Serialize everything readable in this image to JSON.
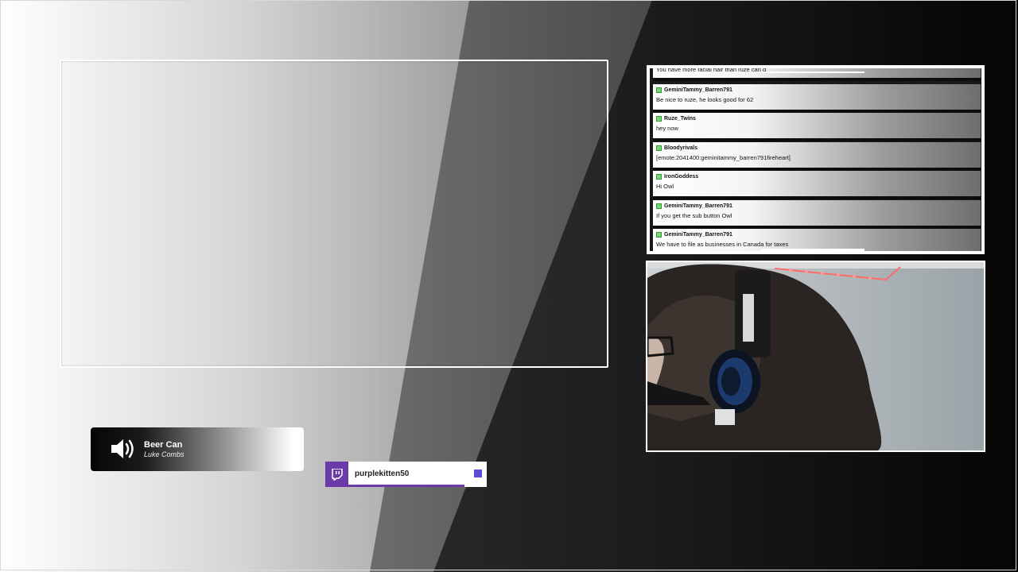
{
  "chat": {
    "messages": [
      {
        "user": "",
        "text": "You have more facial hair than ruze can g"
      },
      {
        "user": "GeminiTammy_Barren791",
        "text": "Be nice to ruze, he looks good for 62"
      },
      {
        "user": "Ruze_Twins",
        "text": "hey now"
      },
      {
        "user": "Bloodyrivals",
        "text": "[emote:2041400:geminitammy_barren791fireheart]"
      },
      {
        "user": "IronGoddess",
        "text": "Hi Owl"
      },
      {
        "user": "GeminiTammy_Barren791",
        "text": "If you get the sub button Owl"
      },
      {
        "user": "GeminiTammy_Barren791",
        "text": "We have to file as businesses in Canada for taxes"
      }
    ],
    "badge_color": "#7bd37b"
  },
  "now_playing": {
    "title": "Beer Can",
    "artist": "Luke Combs",
    "icon": "speaker-icon"
  },
  "latest_follower": {
    "name": "purplekitten50",
    "icon": "twitch-icon",
    "accent": "#6a3aa6"
  },
  "colors": {
    "frame": "#ffffff",
    "follower_square": "#5b4bd8"
  }
}
